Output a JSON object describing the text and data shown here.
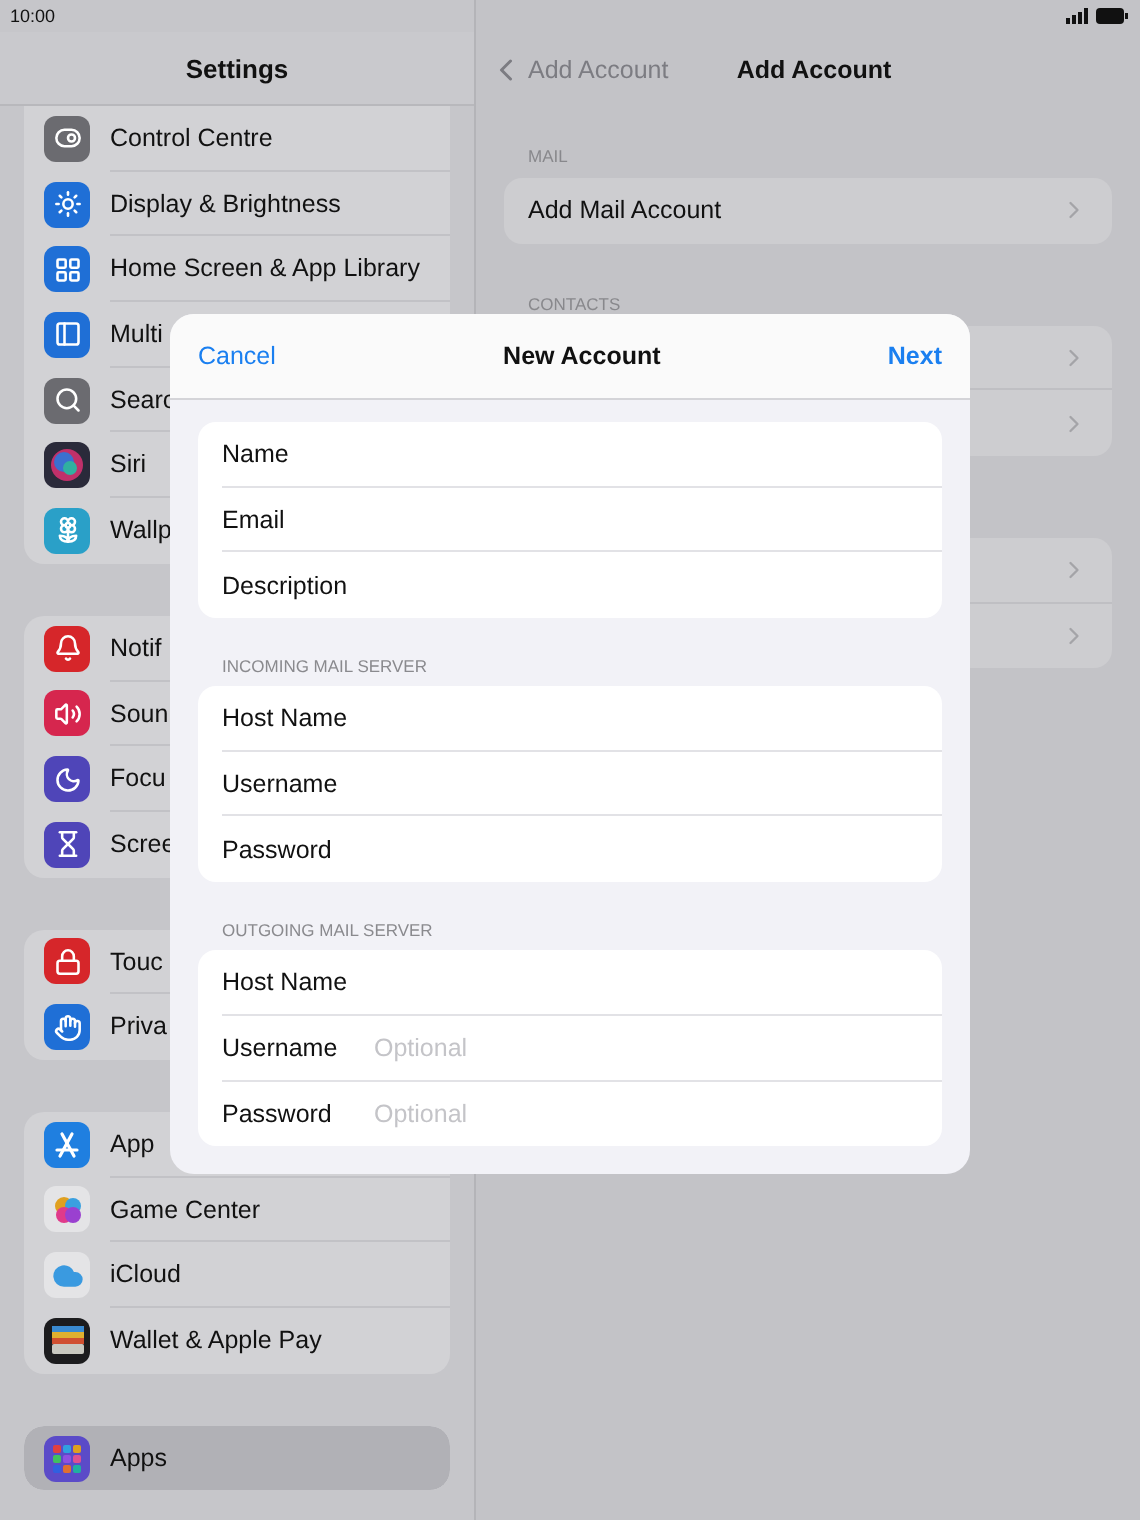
{
  "status_bar": {
    "time": "10:00"
  },
  "sidebar": {
    "title": "Settings",
    "groups": [
      {
        "items": [
          {
            "label": "Control Centre",
            "color": "#6b6b70",
            "selected": false
          },
          {
            "label": "Display & Brightness",
            "color": "#1f6fd6",
            "selected": false
          },
          {
            "label": "Home Screen & App Library",
            "color": "#1f6fd6",
            "selected": false
          },
          {
            "label": "Multi",
            "color": "#1f6fd6",
            "selected": false
          },
          {
            "label": "Searc",
            "color": "#6b6b70",
            "selected": false
          },
          {
            "label": "Siri",
            "color": "#2a2a3a",
            "selected": false
          },
          {
            "label": "Wallp",
            "color": "#2aa0c8",
            "selected": false
          }
        ]
      },
      {
        "items": [
          {
            "label": "Notif",
            "color": "#d6262a",
            "selected": false
          },
          {
            "label": "Soun",
            "color": "#d6264e",
            "selected": false
          },
          {
            "label": "Focu",
            "color": "#4f45b8",
            "selected": false
          },
          {
            "label": "Scree",
            "color": "#4f45b8",
            "selected": false
          }
        ]
      },
      {
        "items": [
          {
            "label": "Touc",
            "color": "#d6262a",
            "selected": false
          },
          {
            "label": "Priva",
            "color": "#1f6fd6",
            "selected": false
          }
        ]
      },
      {
        "items": [
          {
            "label": "App",
            "color": "#1f7fe0",
            "selected": false
          },
          {
            "label": "Game Center",
            "color": "#e4e4e6",
            "selected": false
          },
          {
            "label": "iCloud",
            "color": "#e4e4e6",
            "selected": false
          },
          {
            "label": "Wallet & Apple Pay",
            "color": "#1c1c1e",
            "selected": false
          }
        ]
      },
      {
        "items": [
          {
            "label": "Apps",
            "color": "#5b4bc8",
            "selected": true
          }
        ]
      }
    ]
  },
  "detail": {
    "back": "Add Account",
    "title": "Add Account",
    "sections": [
      {
        "header": "MAIL",
        "rows": [
          {
            "label": "Add Mail Account"
          }
        ]
      },
      {
        "header": "CONTACTS",
        "rows": [
          {
            "kind": "chevron-row"
          },
          {
            "kind": "chevron-row"
          }
        ]
      },
      {
        "rows": [
          {
            "kind": "chevron-row"
          },
          {
            "kind": "chevron-row"
          }
        ]
      }
    ]
  },
  "dialog": {
    "cancel": "Cancel",
    "title": "New Account",
    "next": "Next",
    "sections": [
      {
        "fields": [
          {
            "label": "Name"
          },
          {
            "label": "Email"
          },
          {
            "label": "Description"
          }
        ]
      },
      {
        "header": "INCOMING MAIL SERVER",
        "fields": [
          {
            "label": "Host Name"
          },
          {
            "label": "Username"
          },
          {
            "label": "Password"
          }
        ]
      },
      {
        "header": "OUTGOING MAIL SERVER",
        "fields": [
          {
            "label": "Host Name"
          },
          {
            "label": "Username",
            "placeholder": "Optional"
          },
          {
            "label": "Password",
            "placeholder": "Optional"
          }
        ]
      }
    ]
  }
}
